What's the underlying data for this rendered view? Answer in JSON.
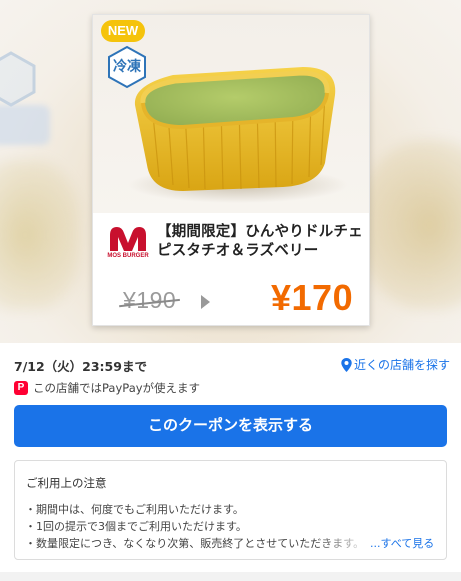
{
  "coupon": {
    "badge_new": "NEW",
    "frozen_label": "冷凍",
    "brand_logo_text": "MOS BURGER",
    "title_line1": "【期間限定】ひんやりドルチェ",
    "title_line2": "ピスタチオ＆ラズベリー",
    "price_original": "¥190",
    "price_discount": "¥170"
  },
  "details": {
    "deadline": "7/12（火）23:59まで",
    "find_store_link": "近くの店舗を探す",
    "paypay_note": "この店舗ではPayPayが使えます",
    "paypay_icon_label": "P",
    "show_coupon_button": "このクーポンを表示する"
  },
  "notice": {
    "title": "ご利用上の注意",
    "items": [
      "・期間中は、何度でもご利用いただけます。",
      "・1回の提示で3個までご利用いただけます。",
      "・数量限定につき、なくなり次第、販売終了とさせていただきます。"
    ],
    "see_all": "...すべて見る"
  },
  "colors": {
    "accent_blue": "#1a73e8",
    "price_orange": "#f26a00",
    "badge_yellow": "#f5c30b",
    "paypay_red": "#ff0033",
    "brand_red": "#c8102e"
  },
  "icons": [
    "new-badge",
    "frozen-hex-icon",
    "mos-burger-logo",
    "arrow-right-icon",
    "location-pin-icon",
    "paypay-icon"
  ]
}
